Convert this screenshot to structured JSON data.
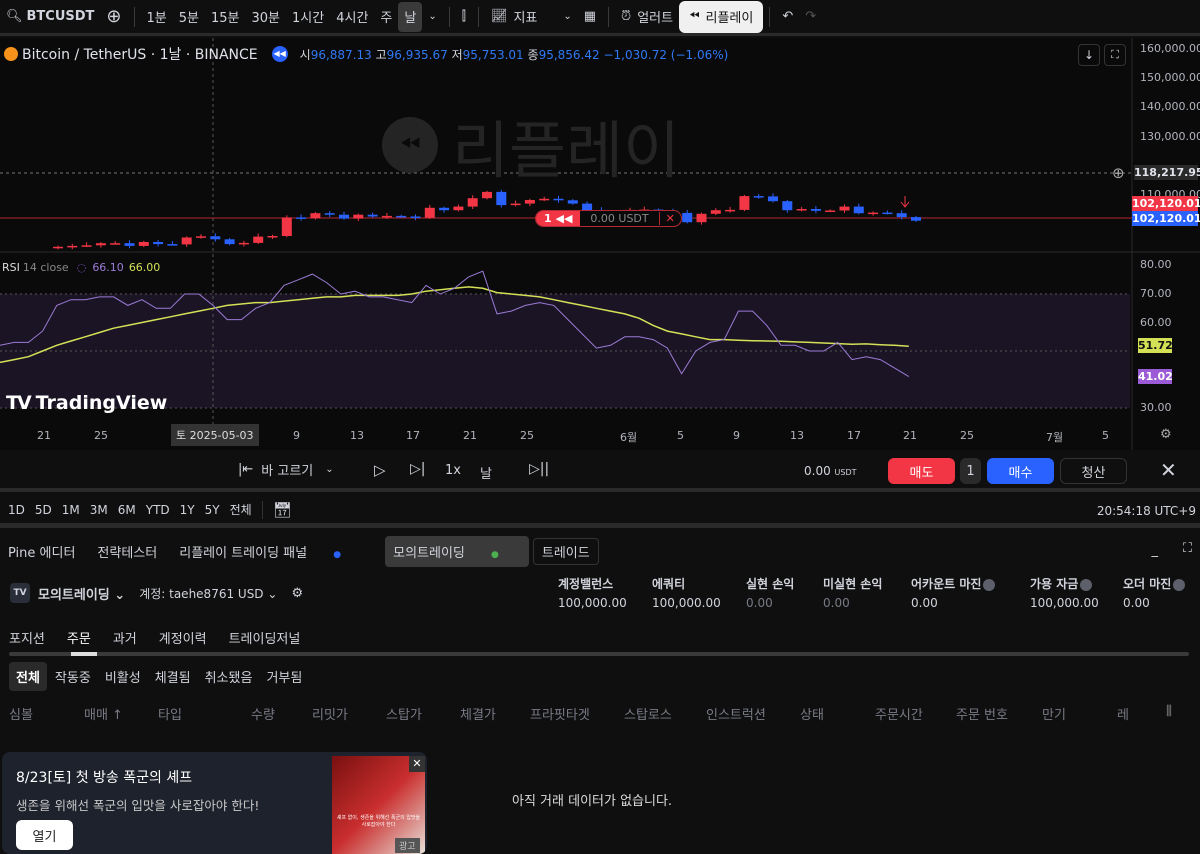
{
  "toolbar": {
    "symbol": "BTCUSDT",
    "intervals": [
      "1분",
      "5분",
      "15분",
      "30분",
      "1시간",
      "4시간",
      "주",
      "날"
    ],
    "indicators": "지표",
    "alert": "얼러트",
    "replay": "리플레이"
  },
  "legend": {
    "title": "Bitcoin / TetherUS · 1날 · BINANCE",
    "o_lbl": "시",
    "o": "96,887.13",
    "h_lbl": "고",
    "h": "96,935.67",
    "l_lbl": "저",
    "l": "95,753.01",
    "c_lbl": "종",
    "c": "95,856.42",
    "chg": "−1,030.72 (−1.06%)"
  },
  "watermark": "리플레이",
  "price_axis": {
    "ticks": [
      "160,000.00",
      "150,000.00",
      "140,000.00",
      "130,000.00",
      "110,000.00"
    ],
    "crosshair_price": "118,217.95",
    "last_price_sell": "102,120.01",
    "last_price_buy": "102,120.01"
  },
  "order_tag": {
    "qty": "1",
    "value": "0.00 USDT"
  },
  "rsi": {
    "label": "RSI",
    "params": "14 close",
    "v1": "66.10",
    "v2": "66.00",
    "ticks": [
      "80.00",
      "70.00",
      "60.00",
      "30.00"
    ],
    "ma_tag": "51.72",
    "rsi_tag": "41.02"
  },
  "logo": "TradingView",
  "time_axis": {
    "ticks": [
      "21",
      "25",
      "9",
      "13",
      "17",
      "21",
      "25",
      "6월",
      "5",
      "9",
      "13",
      "17",
      "21",
      "25",
      "7월",
      "5"
    ],
    "crosshair_date": "토 2025-05-03"
  },
  "chart_data": {
    "type": "candlestick",
    "start_date": "2025-04-22",
    "closes": [
      93.4,
      93.7,
      93.9,
      94.6,
      94.6,
      93.7,
      95.0,
      94.3,
      94.2,
      96.5,
      96.9,
      95.9,
      94.3,
      94.7,
      96.8,
      97.0,
      103.2,
      102.9,
      104.6,
      104.1,
      102.8,
      104.1,
      103.5,
      103.7,
      103.5,
      103.1,
      106.4,
      105.6,
      106.8,
      109.6,
      111.7,
      107.3,
      107.8,
      109.0,
      109.4,
      108.9,
      107.8,
      105.6,
      103.9,
      104.6,
      105.7,
      105.8,
      105.4,
      104.7,
      101.6,
      104.4,
      105.6,
      105.7,
      110.3,
      110.2,
      108.6,
      105.6,
      106.0,
      105.4,
      105.5,
      106.8,
      104.6,
      104.8,
      104.6,
      103.3,
      102.1
    ],
    "units": "thousand USDT",
    "colors": {
      "up": "#f23645",
      "down": "#2962ff"
    },
    "rsi_start_date": "2025-04-18",
    "rsi": [
      52,
      53,
      53,
      57,
      66,
      68,
      68,
      69,
      69,
      66,
      68,
      65,
      65,
      70,
      70,
      66,
      61,
      61,
      65,
      67,
      73,
      75,
      77,
      74,
      70,
      71,
      69,
      69,
      68,
      67,
      73,
      70,
      72,
      76,
      78,
      63,
      64,
      66,
      67,
      66,
      61,
      56,
      51,
      52,
      55,
      55,
      54,
      51,
      42,
      50,
      53,
      54,
      64,
      64,
      59,
      52,
      52,
      50,
      50,
      53,
      47,
      48,
      47,
      44,
      41
    ],
    "rsi_ma": [
      46,
      47,
      48,
      50,
      52,
      53.5,
      55,
      56.5,
      58,
      59,
      60,
      61,
      62,
      63,
      64,
      65,
      66,
      66.5,
      67,
      67,
      67.5,
      68,
      68.5,
      69,
      69,
      69.5,
      69.5,
      69.5,
      69.5,
      70,
      71,
      71.5,
      72,
      72.5,
      72,
      70.5,
      70,
      69.5,
      69,
      68,
      67,
      66,
      65,
      64,
      63,
      61.5,
      59,
      57,
      56,
      55,
      54,
      54,
      53.8,
      53.6,
      53.5,
      53.4,
      53.2,
      53,
      52.8,
      52.6,
      52.4,
      52.5,
      52.2,
      52,
      51.7
    ]
  },
  "replay_bar": {
    "select_bar": "바 고르기",
    "speed": "1x",
    "interval": "날",
    "pnl": "0.00",
    "pnl_unit": "USDT",
    "sell": "매도",
    "qty": "1",
    "buy": "매수",
    "close": "청산"
  },
  "range_bar": {
    "ranges": [
      "1D",
      "5D",
      "1M",
      "3M",
      "6M",
      "YTD",
      "1Y",
      "5Y",
      "전체"
    ],
    "clock": "20:54:18 UTC+9"
  },
  "panel_tabs": [
    "Pine 에디터",
    "전략테스터",
    "리플레이 트레이딩 패널",
    "모의트레이딩",
    "트레이드"
  ],
  "account": {
    "broker": "모의트레이딩",
    "account": "계정: taehe8761 USD",
    "stats": [
      {
        "label": "계정밸런스",
        "value": "100,000.00"
      },
      {
        "label": "에쿼티",
        "value": "100,000.00"
      },
      {
        "label": "실현 손익",
        "value": "0.00"
      },
      {
        "label": "미실현 손익",
        "value": "0.00"
      },
      {
        "label": "어카운트 마진",
        "value": "0.00"
      },
      {
        "label": "가용 자금",
        "value": "100,000.00"
      },
      {
        "label": "오더 마진",
        "value": "0.00"
      }
    ]
  },
  "sub_tabs": [
    "포지션",
    "주문",
    "과거",
    "계정이력",
    "트레이딩저널"
  ],
  "filters": [
    "전체",
    "작동중",
    "비활성",
    "체결됨",
    "취소됐음",
    "거부됨"
  ],
  "columns": [
    "심볼",
    "매매 ↑",
    "타입",
    "수량",
    "리밋가",
    "스탑가",
    "체결가",
    "프라핏타겟",
    "스탑로스",
    "인스트럭션",
    "상태",
    "주문시간",
    "주문 번호",
    "만기",
    "레"
  ],
  "empty": "아직 거래 데이터가 없습니다.",
  "ad": {
    "title": "8/23[토] 첫 방송 폭군의 셰프",
    "body": "생존을 위해선 폭군의 입맛을 사로잡아야 한다!",
    "open": "열기",
    "ad_label": "광고",
    "image_text": "셰프 없이, 생존을 위해선 폭군의 입맛을 사로잡아야 한다"
  }
}
